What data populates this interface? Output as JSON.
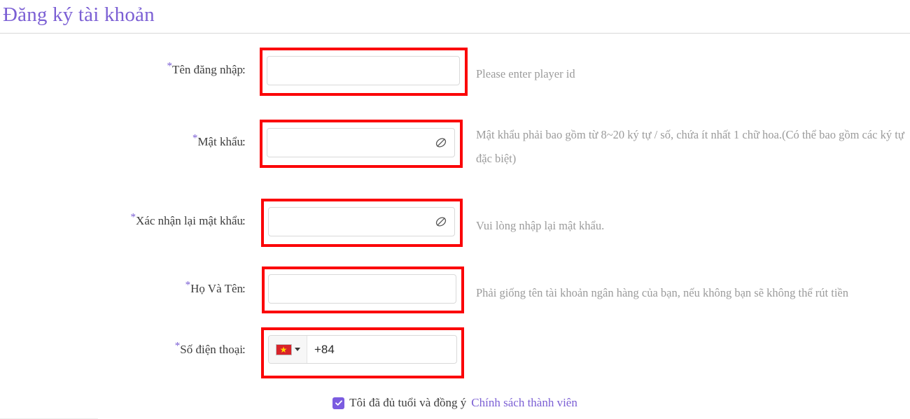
{
  "header": {
    "title": "Đăng ký tài khoản"
  },
  "form": {
    "required_marker": "*",
    "colon": ":",
    "fields": [
      {
        "key": "username",
        "label": "Tên đăng nhập",
        "value": "",
        "placeholder": "",
        "hint": "Please enter player id",
        "type": "text"
      },
      {
        "key": "password",
        "label": "Mật khẩu",
        "value": "",
        "placeholder": "",
        "hint": "Mật khẩu phải bao gồm từ 8~20 ký tự / số, chứa ít nhất 1 chữ hoa.(Có thể bao gồm các ký tự đặc biệt)",
        "type": "password",
        "icon": "eye-slash-icon"
      },
      {
        "key": "confirm_password",
        "label": "Xác nhận lại mật khẩu",
        "value": "",
        "placeholder": "",
        "hint": "Vui lòng nhập lại mật khẩu.",
        "type": "password",
        "icon": "eye-slash-icon"
      },
      {
        "key": "full_name",
        "label": "Họ Và Tên",
        "value": "",
        "placeholder": "",
        "hint": "Phải giống tên tài khoản ngân hàng của bạn, nếu không bạn sẽ không thể rút tiền",
        "type": "text"
      },
      {
        "key": "phone",
        "label": "Số điện thoại",
        "value": "+84",
        "placeholder": "",
        "hint": "",
        "type": "tel",
        "country_flag": "vietnam-flag-icon",
        "country_caret": "chevron-down-icon"
      }
    ]
  },
  "agreement": {
    "checked": true,
    "text": "Tôi đã đủ tuổi và đồng ý",
    "link_text": "Chính sách thành viên"
  },
  "colors": {
    "title_purple": "#7b5fd4",
    "required_star": "#7b5fd4",
    "annotation_red": "#fb0307",
    "hint_gray": "#9b9b9b",
    "label_gray": "#3d3d3d",
    "checkbox_purple": "#7b5ce0",
    "input_border": "#d9d9d9",
    "divider": "#d9d9d9"
  }
}
